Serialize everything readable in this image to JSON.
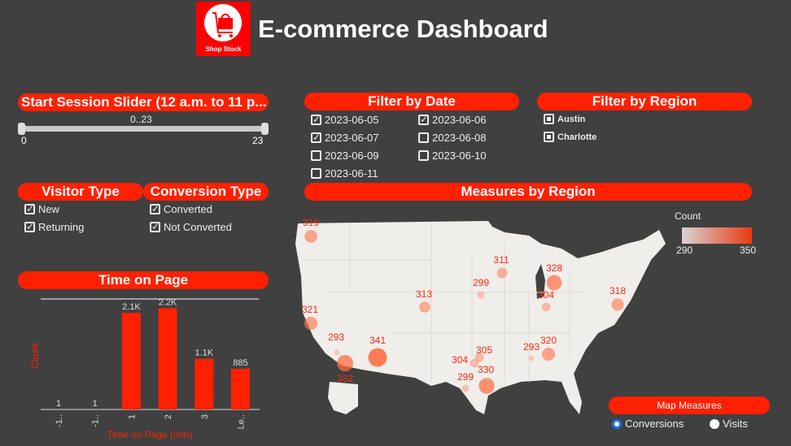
{
  "header": {
    "title": "E-commerce Dashboard",
    "logo_text": "Shop Stock"
  },
  "slider": {
    "title": "Start Session Slider (12 a.m. to 11 p...",
    "range_label": "0..23",
    "min": "0",
    "max": "23",
    "low": 0,
    "high": 23
  },
  "visitor_type": {
    "title": "Visitor Type",
    "items": [
      {
        "label": "New",
        "checked": true
      },
      {
        "label": "Returning",
        "checked": true
      }
    ]
  },
  "conversion_type": {
    "title": "Conversion Type",
    "items": [
      {
        "label": "Converted",
        "checked": true
      },
      {
        "label": "Not Converted",
        "checked": true
      }
    ]
  },
  "date_filter": {
    "title": "Filter by Date",
    "items": [
      {
        "label": "2023-06-05",
        "checked": true
      },
      {
        "label": "2023-06-06",
        "checked": true
      },
      {
        "label": "2023-06-07",
        "checked": true
      },
      {
        "label": "2023-06-08",
        "checked": false
      },
      {
        "label": "2023-06-09",
        "checked": false
      },
      {
        "label": "2023-06-10",
        "checked": false
      },
      {
        "label": "2023-06-11",
        "checked": false
      }
    ]
  },
  "region_filter": {
    "title": "Filter by Region",
    "items": [
      {
        "label": "Austin"
      },
      {
        "label": "Charlotte"
      }
    ]
  },
  "map": {
    "title": "Measures by Region",
    "legend_title": "Count",
    "legend_min": "290",
    "legend_max": "350",
    "values": [
      "319",
      "311",
      "299",
      "328",
      "304",
      "318",
      "313",
      "321",
      "293",
      "341",
      "332",
      "305",
      "304",
      "299",
      "330",
      "293",
      "320"
    ]
  },
  "map_measures": {
    "title": "Map Measures",
    "options": [
      {
        "label": "Conversions",
        "selected": true
      },
      {
        "label": "Visits",
        "selected": false
      }
    ]
  },
  "chart_data": {
    "type": "bar",
    "title": "Time on Page",
    "xlabel": "Time on Page (min)",
    "ylabel": "Count",
    "categories": [
      "-1..",
      "-1..",
      "1",
      "2",
      "3",
      "Le.."
    ],
    "values": [
      1,
      1,
      2100,
      2200,
      1100,
      885
    ],
    "data_labels": [
      "1",
      "1",
      "2.1K",
      "2.2K",
      "1.1K",
      "885"
    ],
    "color": "#ff2000"
  },
  "colors": {
    "accent": "#ff2000",
    "background": "#404040"
  }
}
